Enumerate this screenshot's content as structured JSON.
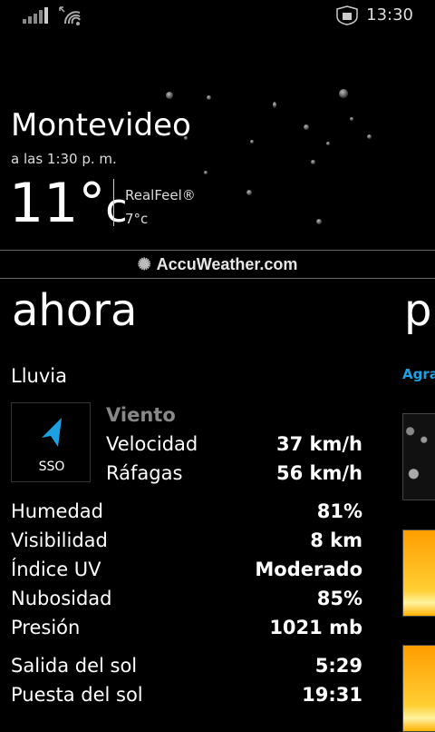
{
  "status_bar": {
    "time": "13:30"
  },
  "header": {
    "city": "Montevideo",
    "as_of": "a las 1:30 p. m.",
    "temp_value": "11°",
    "temp_unit": "c",
    "realfeel_label": "RealFeel®",
    "realfeel_value": "7°c"
  },
  "brand": "AccuWeather.com",
  "panorama": {
    "current_title": "ahora",
    "next_title_peek": "p",
    "next_subtitle_peek": "Agra"
  },
  "current": {
    "condition": "Lluvia",
    "wind": {
      "direction": "SSO",
      "title": "Viento",
      "speed_label": "Velocidad",
      "speed_value": "37 km/h",
      "gust_label": "Ráfagas",
      "gust_value": "56 km/h"
    },
    "details": [
      {
        "label": "Humedad",
        "value": "81%"
      },
      {
        "label": "Visibilidad",
        "value": "8 km"
      },
      {
        "label": "Índice UV",
        "value": "Moderado"
      },
      {
        "label": "Nubosidad",
        "value": "85%"
      },
      {
        "label": "Presión",
        "value": "1021 mb"
      }
    ],
    "sun": [
      {
        "label": "Salida del sol",
        "value": "5:29"
      },
      {
        "label": "Puesta del sol",
        "value": "19:31"
      }
    ]
  }
}
